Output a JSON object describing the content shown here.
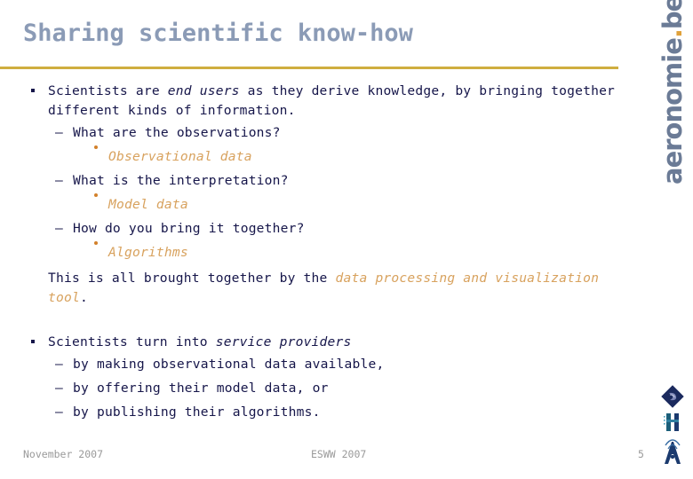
{
  "slide": {
    "title": "Sharing scientific know-how",
    "accent_rule_color": "#cfae3f",
    "title_color": "#8b9bb6",
    "body_color": "#16164a",
    "highlight_color": "#d8a25e"
  },
  "brand": {
    "name": "aeronomie",
    "dot": ".",
    "tld": "be"
  },
  "body": {
    "bullet1": {
      "part1": "Scientists are ",
      "emph1": "end users",
      "part2": " as they derive knowledge, by bringing together different kinds of information.",
      "sub": [
        {
          "question": "What are the observations?",
          "answer": "Observational data"
        },
        {
          "question": "What is the interpretation?",
          "answer": "Model data"
        },
        {
          "question": "How do you bring it together?",
          "answer": "Algorithms"
        }
      ],
      "closing_prefix": "This is all brought together by the ",
      "closing_highlight": "data processing and visualization tool",
      "closing_suffix": "."
    },
    "bullet2": {
      "part1": "Scientists turn into ",
      "emph1": "service providers",
      "sub": [
        "by making observational data available,",
        "by offering their model data, or",
        "by publishing their algorithms."
      ]
    },
    "dash": "–"
  },
  "footer": {
    "date": "November 2007",
    "event": "ESWW 2007",
    "page": "5"
  },
  "logos": {
    "diamond": "bira-iasb-diamond-logo",
    "institute": "institute-h-logo",
    "antenna": "antenna-a-logo"
  }
}
